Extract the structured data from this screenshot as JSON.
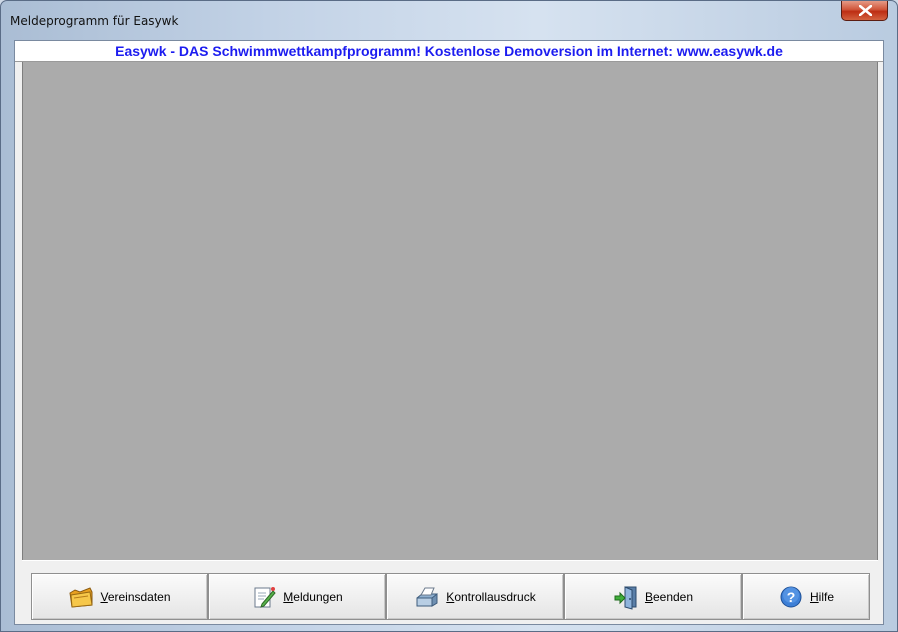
{
  "window": {
    "title": "Meldeprogramm für Easywk",
    "close_icon": "close-icon"
  },
  "banner": {
    "text": "Easywk - DAS Schwimmwettkampfprogramm! Kostenlose Demoversion im Internet: www.easywk.de",
    "color": "#1c1cf0"
  },
  "toolbar": {
    "buttons": [
      {
        "accel": "V",
        "rest": "ereinsdaten",
        "icon": "folder-icon"
      },
      {
        "accel": "M",
        "rest": "eldungen",
        "icon": "edit-document-icon"
      },
      {
        "accel": "K",
        "rest": "ontrollausdruck",
        "icon": "printer-icon"
      },
      {
        "accel": "B",
        "rest": "eenden",
        "icon": "exit-door-icon"
      },
      {
        "accel": "H",
        "rest": "ilfe",
        "icon": "help-icon"
      }
    ]
  },
  "colors": {
    "mdi_background": "#ababab",
    "face": "#f0f0f0"
  }
}
